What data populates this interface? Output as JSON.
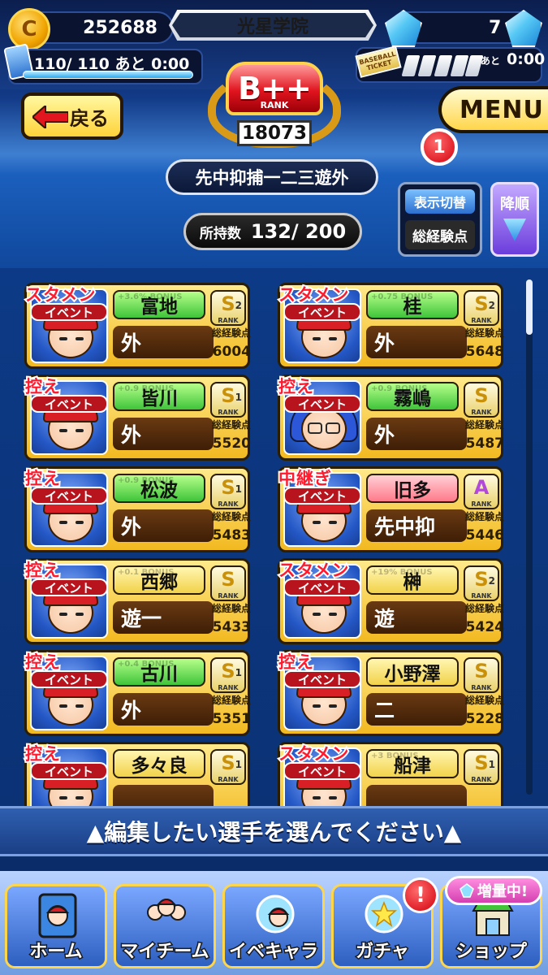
{
  "header": {
    "coins": "252688",
    "school_name": "光星学院",
    "gems": "7",
    "stamina": "110/ 110 あと 0:00",
    "ticket_label": "BASEBALL TICKET",
    "ticket_ato": "あと",
    "ticket_time": "0:00",
    "rank_label": "B++",
    "rank_sub": "RANK",
    "rank_value": "18073",
    "back_label": "戻る",
    "menu_label": "MENU",
    "menu_notification": "1"
  },
  "controls": {
    "position_filter": "先中抑捕一二三遊外",
    "count_label": "所持数",
    "count_value": "132/ 200",
    "display_toggle": "表示切替",
    "sort_key": "総経験点",
    "sort_order": "降順"
  },
  "players": [
    {
      "role": "スタメン",
      "event": "イベント",
      "name": "富地",
      "bonus": "+3.6% BONUS",
      "color": "green",
      "rank": "S",
      "rank_num": "2",
      "position": "外",
      "exp_label": "総経験点",
      "exp": "6004"
    },
    {
      "role": "スタメン",
      "event": "イベント",
      "name": "桂",
      "bonus": "+0.75 BONUS",
      "color": "green",
      "rank": "S",
      "rank_num": "2",
      "position": "外",
      "exp_label": "総経験点",
      "exp": "5648"
    },
    {
      "role": "控え",
      "event": "イベント",
      "name": "皆川",
      "bonus": "+0.9 BONUS",
      "color": "green",
      "rank": "S",
      "rank_num": "1",
      "position": "外",
      "exp_label": "総経験点",
      "exp": "5520"
    },
    {
      "role": "控え",
      "event": "イベント",
      "name": "霧嶋",
      "bonus": "+0.9 BONUS",
      "color": "green",
      "rank": "S",
      "rank_num": "",
      "position": "外",
      "exp_label": "総経験点",
      "exp": "5487"
    },
    {
      "role": "控え",
      "event": "イベント",
      "name": "松波",
      "bonus": "+0.9 BONUS",
      "color": "green",
      "rank": "S",
      "rank_num": "1",
      "position": "外",
      "exp_label": "総経験点",
      "exp": "5483"
    },
    {
      "role": "中継ぎ",
      "event": "イベント",
      "name": "旧多",
      "bonus": "",
      "color": "pink",
      "rank": "A",
      "rank_num": "",
      "position": "先中抑",
      "exp_label": "総経験点",
      "exp": "5446"
    },
    {
      "role": "控え",
      "event": "イベント",
      "name": "西郷",
      "bonus": "+0.1 BONUS",
      "color": "yellow",
      "rank": "S",
      "rank_num": "",
      "position": "遊一",
      "exp_label": "総経験点",
      "exp": "5433"
    },
    {
      "role": "スタメン",
      "event": "イベント",
      "name": "榊",
      "bonus": "+19% BONUS",
      "color": "yellow",
      "rank": "S",
      "rank_num": "2",
      "position": "遊",
      "exp_label": "総経験点",
      "exp": "5424"
    },
    {
      "role": "控え",
      "event": "イベント",
      "name": "古川",
      "bonus": "+0.4 BONUS",
      "color": "green",
      "rank": "S",
      "rank_num": "1",
      "position": "外",
      "exp_label": "総経験点",
      "exp": "5351"
    },
    {
      "role": "控え",
      "event": "イベント",
      "name": "小野澤",
      "bonus": "",
      "color": "yellow",
      "rank": "S",
      "rank_num": "",
      "position": "二",
      "exp_label": "総経験点",
      "exp": "5228"
    },
    {
      "role": "控え",
      "event": "イベント",
      "name": "多々良",
      "bonus": "",
      "color": "yellow",
      "rank": "S",
      "rank_num": "1",
      "position": "",
      "exp_label": "",
      "exp": ""
    },
    {
      "role": "スタメン",
      "event": "イベント",
      "name": "船津",
      "bonus": "+3 BONUS",
      "color": "yellow",
      "rank": "S",
      "rank_num": "1",
      "position": "",
      "exp_label": "",
      "exp": ""
    }
  ],
  "instruction": "▲編集したい選手を選んでください▲",
  "nav": {
    "home": "ホーム",
    "my_team": "マイチーム",
    "event_chara": "イベキャラ",
    "gacha": "ガチャ",
    "shop": "ショップ",
    "increase_badge": "増量中!",
    "alert": "!"
  },
  "colors": {
    "accent_yellow": "#ffd54a",
    "role_red": "#ff1a2e",
    "panel_blue": "#0d3a86"
  }
}
